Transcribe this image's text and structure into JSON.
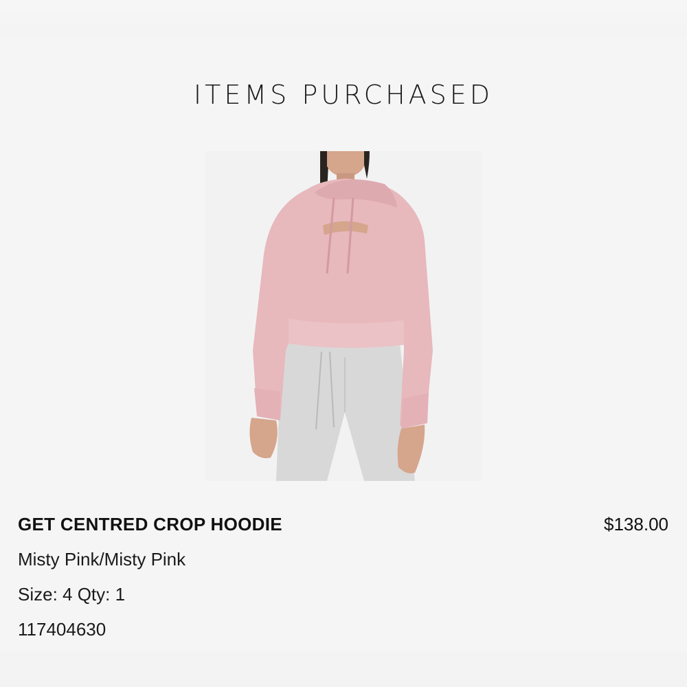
{
  "section": {
    "title": "ITEMS PURCHASED"
  },
  "item": {
    "image_alt": "Woman wearing pink cropped hoodie and grey joggers",
    "name": "GET CENTRED CROP HOODIE",
    "price": "$138.00",
    "color": "Misty Pink/Misty Pink",
    "size_qty": "Size: 4 Qty: 1",
    "sku": "117404630"
  },
  "colors": {
    "background": "#f5f5f5",
    "hoodie": "#e8b9bd",
    "joggers": "#d9d9d9",
    "text": "#141414"
  }
}
